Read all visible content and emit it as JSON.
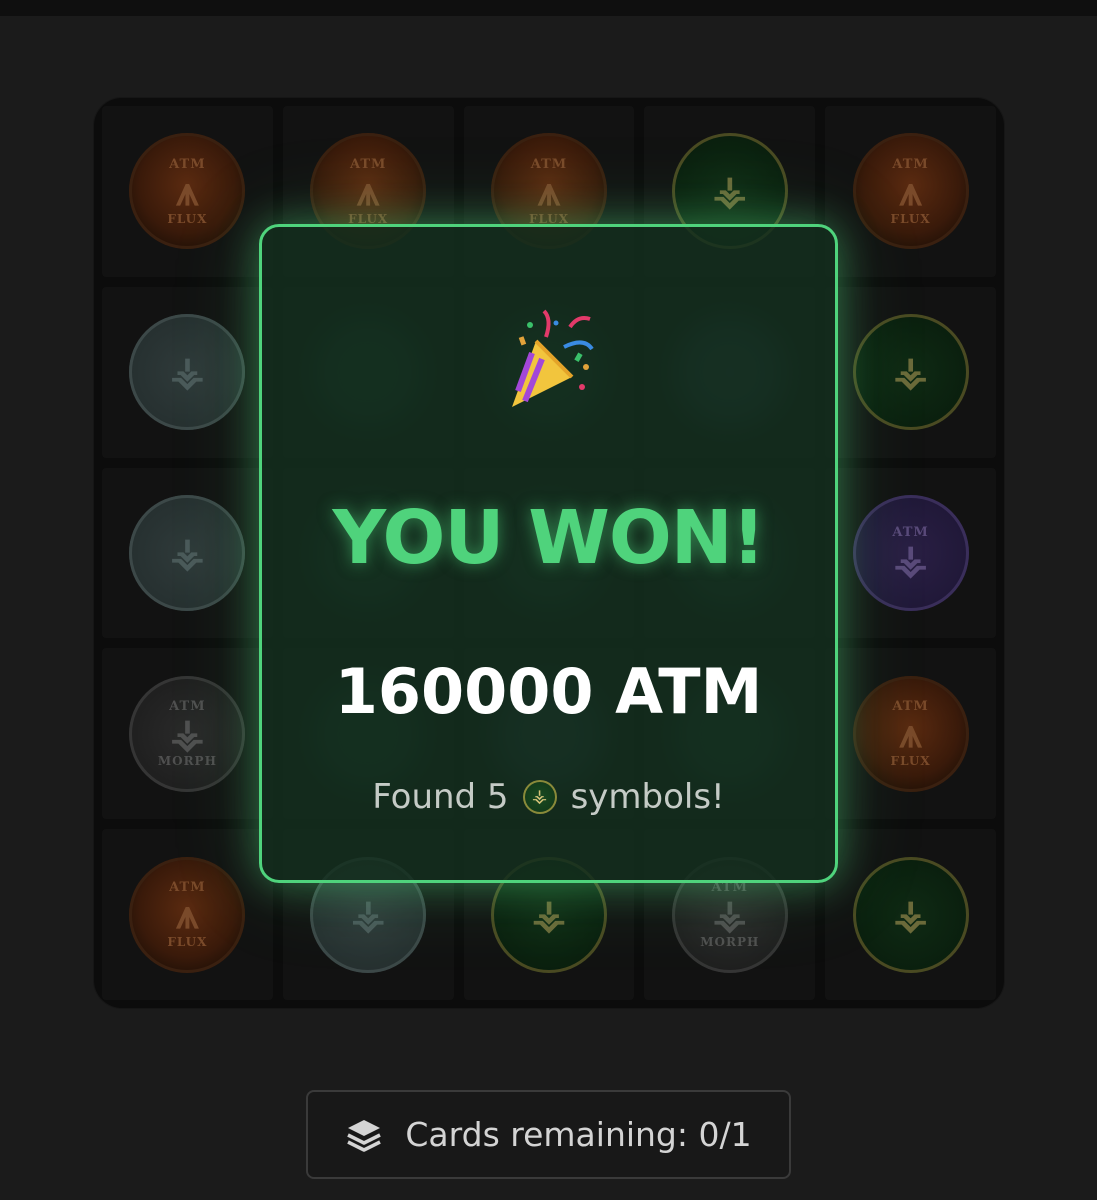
{
  "board": {
    "rows": [
      [
        "flux",
        "flux",
        "flux",
        "rune",
        "flux"
      ],
      [
        "silver",
        "g-blur",
        "g-blur",
        "b-blur",
        "rune"
      ],
      [
        "silver",
        "g-blur",
        "g-blur",
        "g-blur",
        "ether"
      ],
      [
        "morph",
        "g-blur",
        "b-blur",
        "g-blur",
        "flux"
      ],
      [
        "flux",
        "silver",
        "rune",
        "morph",
        "rune"
      ]
    ],
    "coin_text": {
      "flux": {
        "top": "ATM",
        "glyph": "⩚",
        "bottom": "FLUX"
      },
      "rune": {
        "top": "",
        "glyph": "⚶",
        "bottom": ""
      },
      "silver": {
        "top": "",
        "glyph": "⚶",
        "bottom": ""
      },
      "morph": {
        "top": "ATM",
        "glyph": "⚶",
        "bottom": "MORPH"
      },
      "ether": {
        "top": "ATM",
        "glyph": "⚶",
        "bottom": ""
      },
      "g-blur": {
        "top": "",
        "glyph": "",
        "bottom": ""
      },
      "b-blur": {
        "top": "",
        "glyph": "",
        "bottom": ""
      }
    }
  },
  "result": {
    "icon": "party-popper-icon",
    "title": "YOU WON!",
    "amount": "160000 ATM",
    "found_prefix": "Found 5",
    "found_symbol_icon": "atm-rune-coin-icon",
    "found_suffix": "symbols!"
  },
  "footer": {
    "icon": "layers-icon",
    "cards_remaining_label": "Cards remaining: 0/1"
  },
  "colors": {
    "accent_green": "#4fd37c",
    "background": "#1b1b1b"
  }
}
